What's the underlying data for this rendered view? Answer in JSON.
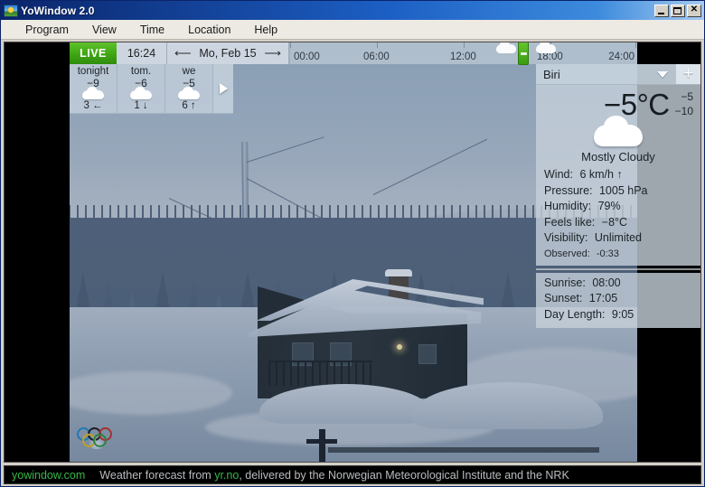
{
  "window": {
    "title": "YoWindow 2.0",
    "icon": "sun-landscape-icon",
    "buttons": {
      "minimize": "_",
      "maximize": "□",
      "close": "✕"
    }
  },
  "menubar": {
    "items": [
      {
        "label": "Program"
      },
      {
        "label": "View"
      },
      {
        "label": "Time"
      },
      {
        "label": "Location"
      },
      {
        "label": "Help"
      }
    ]
  },
  "topbar": {
    "live_label": "LIVE",
    "clock": "16:24",
    "date": "Mo, Feb 15",
    "prev_arrow": "⟵",
    "next_arrow": "⟶",
    "timeline": {
      "ticks": [
        "00:00",
        "06:00",
        "12:00",
        "18:00",
        "24:00"
      ],
      "marker_time": "16:24"
    }
  },
  "forecast": {
    "cards": [
      {
        "day": "tonight",
        "temp": "−9",
        "icon": "cloud-icon",
        "wind": "3 ←"
      },
      {
        "day": "tom.",
        "temp": "−6",
        "icon": "cloud-icon",
        "wind": "1 ↓"
      },
      {
        "day": "we",
        "temp": "−5",
        "icon": "cloud-icon",
        "wind": "6 ↑"
      }
    ],
    "expander_icon": "play-triangle-icon"
  },
  "weather_panel": {
    "location": "Biri",
    "location_caret": "chevron-down-icon",
    "add_label": "+",
    "temperature": "−5°C",
    "high": "−5",
    "low": "−10",
    "condition_icon": "cloud-icon",
    "condition": "Mostly Cloudy",
    "details": [
      {
        "label": "Wind:",
        "value": "6 km/h ↑"
      },
      {
        "label": "Pressure:",
        "value": "1005 hPa"
      },
      {
        "label": "Humidity:",
        "value": "79%"
      },
      {
        "label": "Feels like:",
        "value": "−8°C"
      },
      {
        "label": "Visibility:",
        "value": "Unlimited"
      }
    ],
    "observed": {
      "label": "Observed:",
      "value": "-0:33"
    },
    "sun": [
      {
        "label": "Sunrise:",
        "value": "08:00"
      },
      {
        "label": "Sunset:",
        "value": "17:05"
      },
      {
        "label": "Day Length:",
        "value": "9:05"
      }
    ]
  },
  "statusbar": {
    "site_link": "yowindow.com",
    "text_before": "Weather forecast from ",
    "source_link": "yr.no",
    "text_after": ", delivered by the Norwegian Meteorological Institute and the NRK"
  },
  "colors": {
    "live_green": "#3fa514",
    "link_green": "#39b54a",
    "title_blue": "#0a246a",
    "panel_grey": "#c6d2dd"
  }
}
